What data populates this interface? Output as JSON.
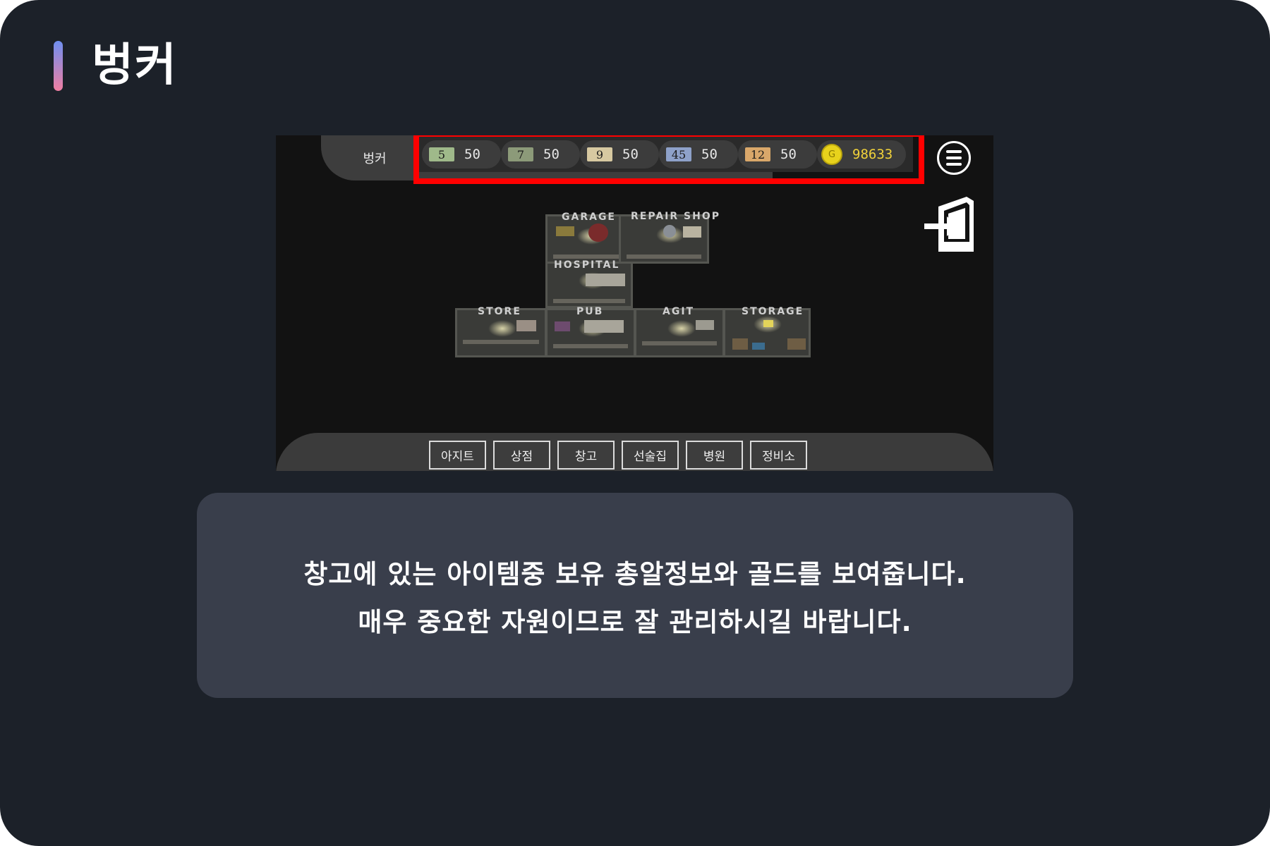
{
  "page_title": "벙커",
  "game": {
    "top_tab_label": "벙커",
    "resources": [
      {
        "icon": "ammo-5-icon",
        "icon_label": "5",
        "value": "50",
        "color": "#9fb98a"
      },
      {
        "icon": "ammo-7-icon",
        "icon_label": "7",
        "value": "50",
        "color": "#8c9a79"
      },
      {
        "icon": "ammo-9-icon",
        "icon_label": "9",
        "value": "50",
        "color": "#d7c9a1"
      },
      {
        "icon": "ammo-45-icon",
        "icon_label": "45",
        "value": "50",
        "color": "#8ea1c9"
      },
      {
        "icon": "ammo-12-icon",
        "icon_label": "12",
        "value": "50",
        "color": "#d9a76a"
      }
    ],
    "gold": {
      "icon": "gold-coin-icon",
      "icon_label": "G",
      "value": "98633",
      "color": "#e8d21c"
    },
    "highlight_color": "#ff0000",
    "rooms": [
      "GARAGE",
      "REPAIR SHOP",
      "HOSPITAL",
      "STORE",
      "PUB",
      "AGIT",
      "STORAGE"
    ],
    "nav": [
      "아지트",
      "상점",
      "창고",
      "선술집",
      "병원",
      "정비소"
    ]
  },
  "caption": {
    "line1": "창고에 있는 아이템중 보유 총알정보와 골드를 보여줍니다.",
    "line2": "매우 중요한 자원이므로 잘 관리하시길 바랍니다."
  }
}
